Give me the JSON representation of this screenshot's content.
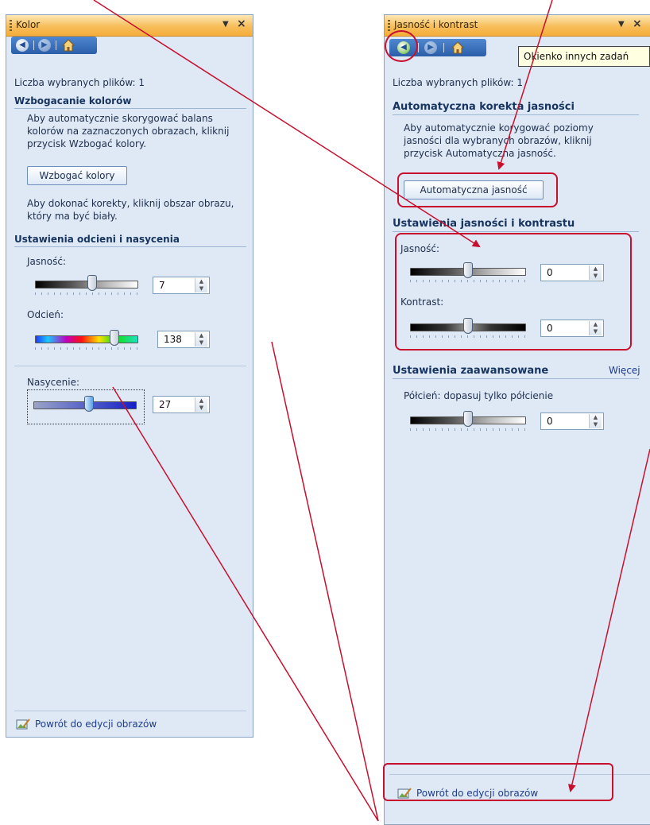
{
  "left_panel": {
    "title": "Kolor",
    "files_label": "Liczba wybranych plików: 1",
    "section_enhance": "Wzbogacanie kolorów",
    "enhance_desc": [
      "Aby automatycznie skorygować balans",
      "kolorów na zaznaczonych obrazach, kliknij",
      "przycisk Wzbogać kolory."
    ],
    "enhance_button": "Wzbogać kolory",
    "correct_desc": [
      "Aby dokonać korekty, kliknij obszar obrazu,",
      "który ma być biały."
    ],
    "section_hue": "Ustawienia odcieni i nasycenia",
    "brightness_label": "Jasność:",
    "brightness_value": "7",
    "hue_label": "Odcień:",
    "hue_value": "138",
    "saturation_label": "Nasycenie:",
    "saturation_value": "27",
    "footer_link": "Powrót do edycji obrazów"
  },
  "right_panel": {
    "title": "Jasność i kontrast",
    "tooltip": "Okienko innych zadań",
    "files_label": "Liczba wybranych plików: 1",
    "section_auto": "Automatyczna korekta jasności",
    "auto_desc": [
      "Aby automatycznie korygować poziomy",
      "jasności dla wybranych obrazów, kliknij",
      "przycisk Automatyczna jasność."
    ],
    "auto_button": "Automatyczna jasność",
    "section_bc": "Ustawienia jasności i kontrastu",
    "brightness_label": "Jasność:",
    "brightness_value": "0",
    "contrast_label": "Kontrast:",
    "contrast_value": "0",
    "section_advanced": "Ustawienia zaawansowane",
    "more_link": "Więcej",
    "midtones_label": "Półcień: dopasuj tylko półcienie",
    "midtones_value": "0",
    "footer_link": "Powrót do edycji obrazów"
  },
  "slider_levels": {
    "left_brightness": 0.55,
    "left_hue": 0.77,
    "left_saturation": 0.54,
    "right_brightness": 0.5,
    "right_contrast": 0.5,
    "right_midtones": 0.5
  },
  "colors": {
    "annotation_red": "#c8102e",
    "panel_bg": "#dfe9f5",
    "titlebar_orange": "#f7be5a",
    "tooltip_bg": "#ffffe1"
  },
  "icons": [
    "back-icon",
    "forward-icon",
    "home-icon",
    "dropdown-arrow-icon",
    "close-icon",
    "edit-picture-icon"
  ]
}
